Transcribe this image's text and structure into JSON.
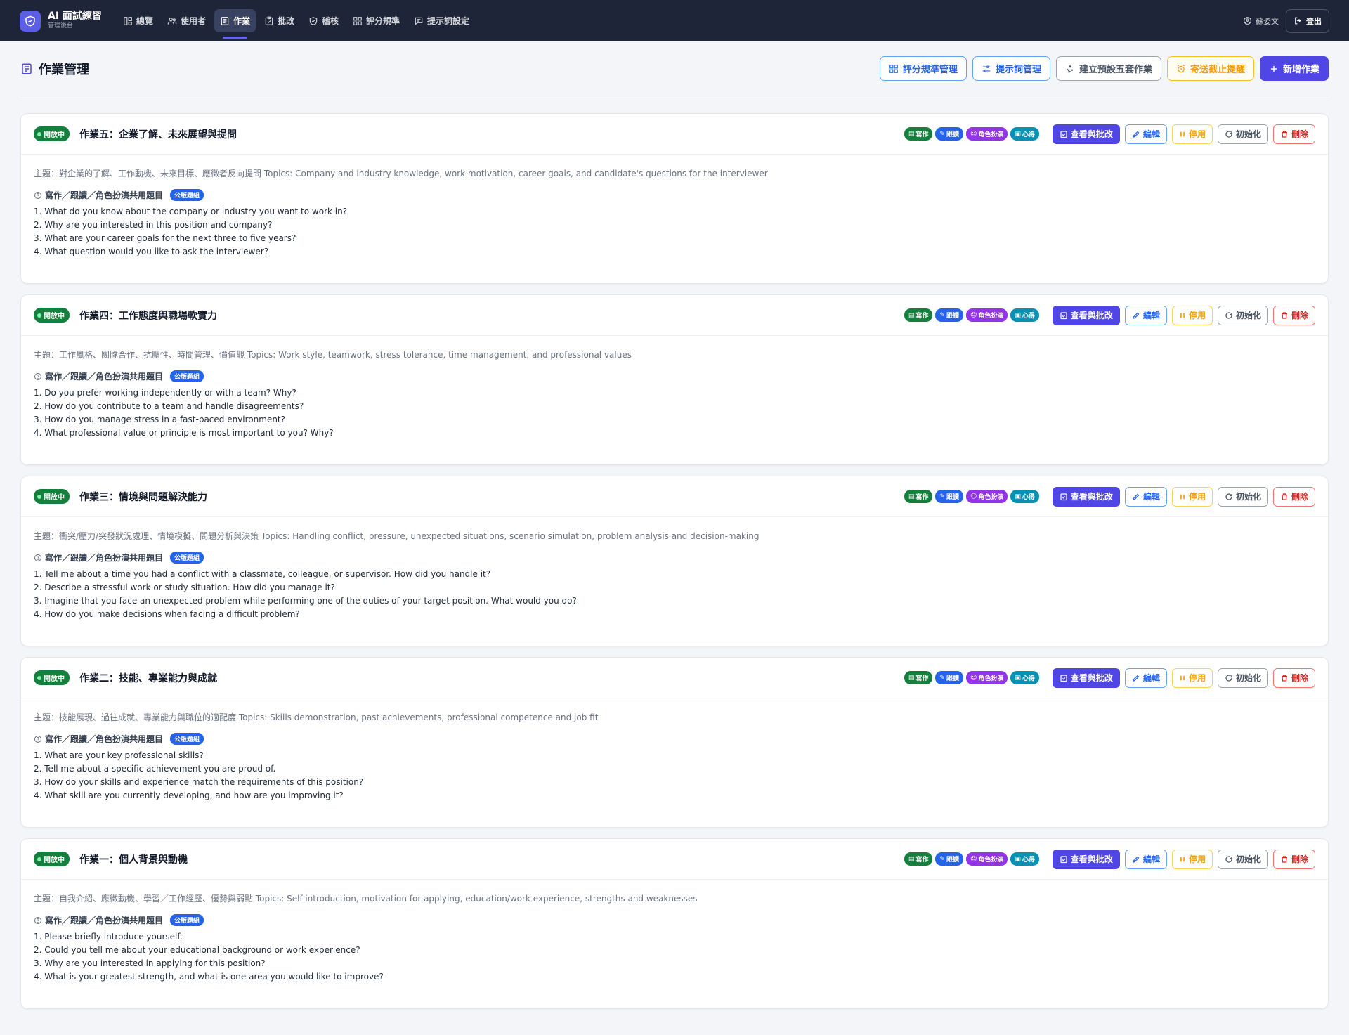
{
  "app": {
    "title": "AI 面試練習",
    "subtitle": "管理後台"
  },
  "nav": [
    {
      "label": "總覽",
      "icon": "dashboard-icon",
      "active": false
    },
    {
      "label": "使用者",
      "icon": "users-icon",
      "active": false
    },
    {
      "label": "作業",
      "icon": "document-icon",
      "active": true
    },
    {
      "label": "批改",
      "icon": "clipboard-check-icon",
      "active": false
    },
    {
      "label": "稽核",
      "icon": "shield-icon",
      "active": false
    },
    {
      "label": "評分規準",
      "icon": "grid-icon",
      "active": false
    },
    {
      "label": "提示詞設定",
      "icon": "message-icon",
      "active": false
    }
  ],
  "user": {
    "name": "蘇姿文",
    "logout_label": "登出"
  },
  "page": {
    "title": "作業管理",
    "actions": {
      "rubric": "評分規準管理",
      "prompt": "提示詞管理",
      "preset": "建立預設五套作業",
      "remind": "寄送截止提醒",
      "add": "新增作業"
    }
  },
  "card_labels": {
    "tags": [
      "寫作",
      "跟讀",
      "角色扮演",
      "心得"
    ],
    "review": "查看與批改",
    "edit": "編輯",
    "pause": "停用",
    "init": "初始化",
    "delete": "刪除",
    "question_head": "寫作／跟讀／角色扮演共用題目",
    "public_badge": "公版題組"
  },
  "assignments": [
    {
      "status": "開放中",
      "title": "作業五：企業了解、未來展望與提問",
      "topic": "主題：對企業的了解、工作動機、未來目標、應徵者反向提問 Topics: Company and industry knowledge, work motivation, career goals, and candidate's questions for the interviewer",
      "questions": [
        "1. What do you know about the company or industry you want to work in?",
        "2. Why are you interested in this position and company?",
        "3. What are your career goals for the next three to five years?",
        "4. What question would you like to ask the interviewer?"
      ]
    },
    {
      "status": "開放中",
      "title": "作業四：工作態度與職場軟實力",
      "topic": "主題：工作風格、團隊合作、抗壓性、時間管理、價值觀 Topics: Work style, teamwork, stress tolerance, time management, and professional values",
      "questions": [
        "1. Do you prefer working independently or with a team? Why?",
        "2. How do you contribute to a team and handle disagreements?",
        "3. How do you manage stress in a fast-paced environment?",
        "4. What professional value or principle is most important to you? Why?"
      ]
    },
    {
      "status": "開放中",
      "title": "作業三：情境與問題解決能力",
      "topic": "主題：衝突/壓力/突發狀況處理、情境模擬、問題分析與決策 Topics: Handling conflict, pressure, unexpected situations, scenario simulation, problem analysis and decision-making",
      "questions": [
        "1. Tell me about a time you had a conflict with a classmate, colleague, or supervisor. How did you handle it?",
        "2. Describe a stressful work or study situation. How did you manage it?",
        "3. Imagine that you face an unexpected problem while performing one of the duties of your target position. What would you do?",
        "4. How do you make decisions when facing a difficult problem?"
      ]
    },
    {
      "status": "開放中",
      "title": "作業二：技能、專業能力與成就",
      "topic": "主題：技能展現、過往成就、專業能力與職位的適配度 Topics: Skills demonstration, past achievements, professional competence and job fit",
      "questions": [
        "1. What are your key professional skills?",
        "2. Tell me about a specific achievement you are proud of.",
        "3. How do your skills and experience match the requirements of this position?",
        "4. What skill are you currently developing, and how are you improving it?"
      ]
    },
    {
      "status": "開放中",
      "title": "作業一：個人背景與動機",
      "topic": "主題：自我介紹、應徵動機、學習／工作經歷、優勢與弱點 Topics: Self-introduction, motivation for applying, education/work experience, strengths and weaknesses",
      "questions": [
        "1. Please briefly introduce yourself.",
        "2. Could you tell me about your educational background or work experience?",
        "3. Why are you interested in applying for this position?",
        "4. What is your greatest strength, and what is one area you would like to improve?"
      ]
    }
  ]
}
